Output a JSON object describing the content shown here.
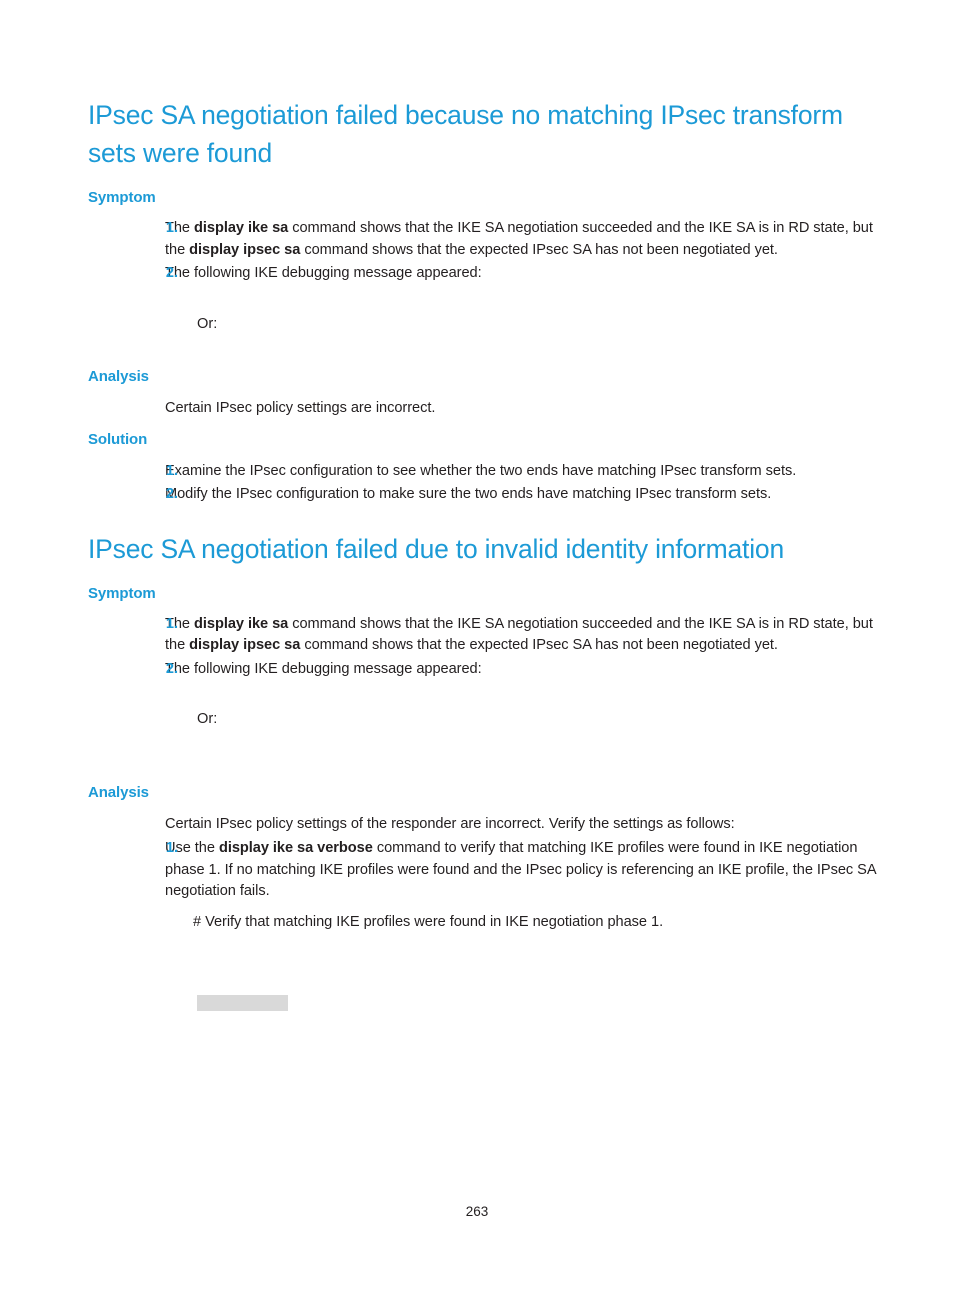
{
  "colors": {
    "heading_blue": "#1c9ad6",
    "body_black": "#231f20",
    "redaction_gray": "#d9d9d9",
    "page_background": "#ffffff"
  },
  "sections": [
    {
      "id": "no-matching-transform-sets",
      "title": "IPsec SA negotiation failed because no matching IPsec transform sets were found",
      "symptom": {
        "label": "Symptom",
        "items": [
          {
            "number": "1.",
            "parts": [
              {
                "text": "The ",
                "bold": false
              },
              {
                "text": "display ike sa",
                "bold": true
              },
              {
                "text": " command shows that the IKE SA negotiation succeeded and the IKE SA is in RD state, but the ",
                "bold": false
              },
              {
                "text": "display ipsec sa",
                "bold": true
              },
              {
                "text": " command shows that the expected IPsec SA has not been negotiated yet.",
                "bold": false
              }
            ]
          },
          {
            "number": "2.",
            "parts": [
              {
                "text": "The following IKE debugging message appeared:",
                "bold": false
              }
            ]
          }
        ],
        "or_label": "Or:"
      },
      "analysis": {
        "label": "Analysis",
        "paragraph": "Certain IPsec policy settings are incorrect."
      },
      "solution": {
        "label": "Solution",
        "items": [
          {
            "number": "1.",
            "parts": [
              {
                "text": "Examine the IPsec configuration to see whether the two ends have matching IPsec transform sets.",
                "bold": false
              }
            ]
          },
          {
            "number": "2.",
            "parts": [
              {
                "text": "Modify the IPsec configuration to make sure the two ends have matching IPsec transform sets.",
                "bold": false
              }
            ]
          }
        ]
      }
    },
    {
      "id": "invalid-identity-information",
      "title": "IPsec SA negotiation failed due to invalid identity information",
      "symptom": {
        "label": "Symptom",
        "items": [
          {
            "number": "1.",
            "parts": [
              {
                "text": "The ",
                "bold": false
              },
              {
                "text": "display ike sa",
                "bold": true
              },
              {
                "text": " command shows that the IKE SA negotiation succeeded and the IKE SA is in RD state, but the ",
                "bold": false
              },
              {
                "text": "display ipsec sa",
                "bold": true
              },
              {
                "text": " command shows that the expected IPsec SA has not been negotiated yet.",
                "bold": false
              }
            ]
          },
          {
            "number": "2.",
            "parts": [
              {
                "text": "The following IKE debugging message appeared:",
                "bold": false
              }
            ]
          }
        ],
        "or_label": "Or:"
      },
      "analysis": {
        "label": "Analysis",
        "paragraph": "Certain IPsec policy settings of the responder are incorrect. Verify the settings as follows:",
        "items": [
          {
            "number": "1.",
            "parts": [
              {
                "text": "Use the ",
                "bold": false
              },
              {
                "text": "display ike sa verbose",
                "bold": true
              },
              {
                "text": " command to verify that matching IKE profiles were found in IKE negotiation phase 1. If no matching IKE profiles were found and the IPsec policy is referencing an IKE profile, the IPsec SA negotiation fails.",
                "bold": false
              }
            ]
          }
        ],
        "comment_line": "# Verify that matching IKE profiles were found in IKE negotiation phase 1."
      }
    }
  ],
  "footer": {
    "page_number": "263"
  }
}
